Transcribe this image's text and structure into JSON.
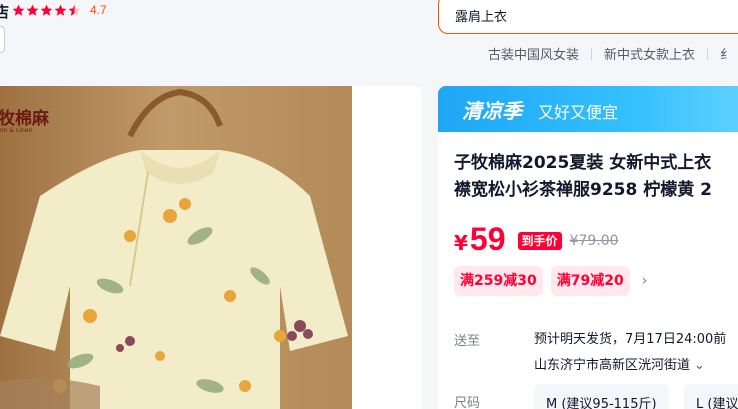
{
  "store": {
    "name_fragment": "店",
    "rating": "4.7",
    "stars_filled": 4.5,
    "star_color": "#ff0036"
  },
  "search": {
    "value": "露肩上衣"
  },
  "hot_searches": [
    "古装中国风女装",
    "新中式女款上衣",
    "纟"
  ],
  "product_image": {
    "brand_logo": "牧棉麻",
    "brand_sub": "on & Linen"
  },
  "season_banner": {
    "title": "清凉季",
    "subtitle": "又好又便宜"
  },
  "product": {
    "title_line1": "子牧棉麻2025夏装 女新中式上衣",
    "title_line2": "襟宽松小衫茶禅服9258 柠檬黄 2"
  },
  "price": {
    "currency": "¥",
    "value": "59",
    "tag": "到手价",
    "original": "¥79.00"
  },
  "coupons": [
    "满259减30",
    "满79减20"
  ],
  "coupon_more_icon": "chevron-right-icon",
  "delivery": {
    "label": "送至",
    "text": "预计明天发货，7月17日24:00前",
    "address": "山东济宁市高新区洸河街道"
  },
  "size": {
    "label": "尺码",
    "options": [
      "M (建议95-115斤)",
      "L (建议"
    ]
  },
  "colors": {
    "accent": "#ff5000",
    "price_red": "#ff0036",
    "banner_blue": "#1fa6f5"
  }
}
